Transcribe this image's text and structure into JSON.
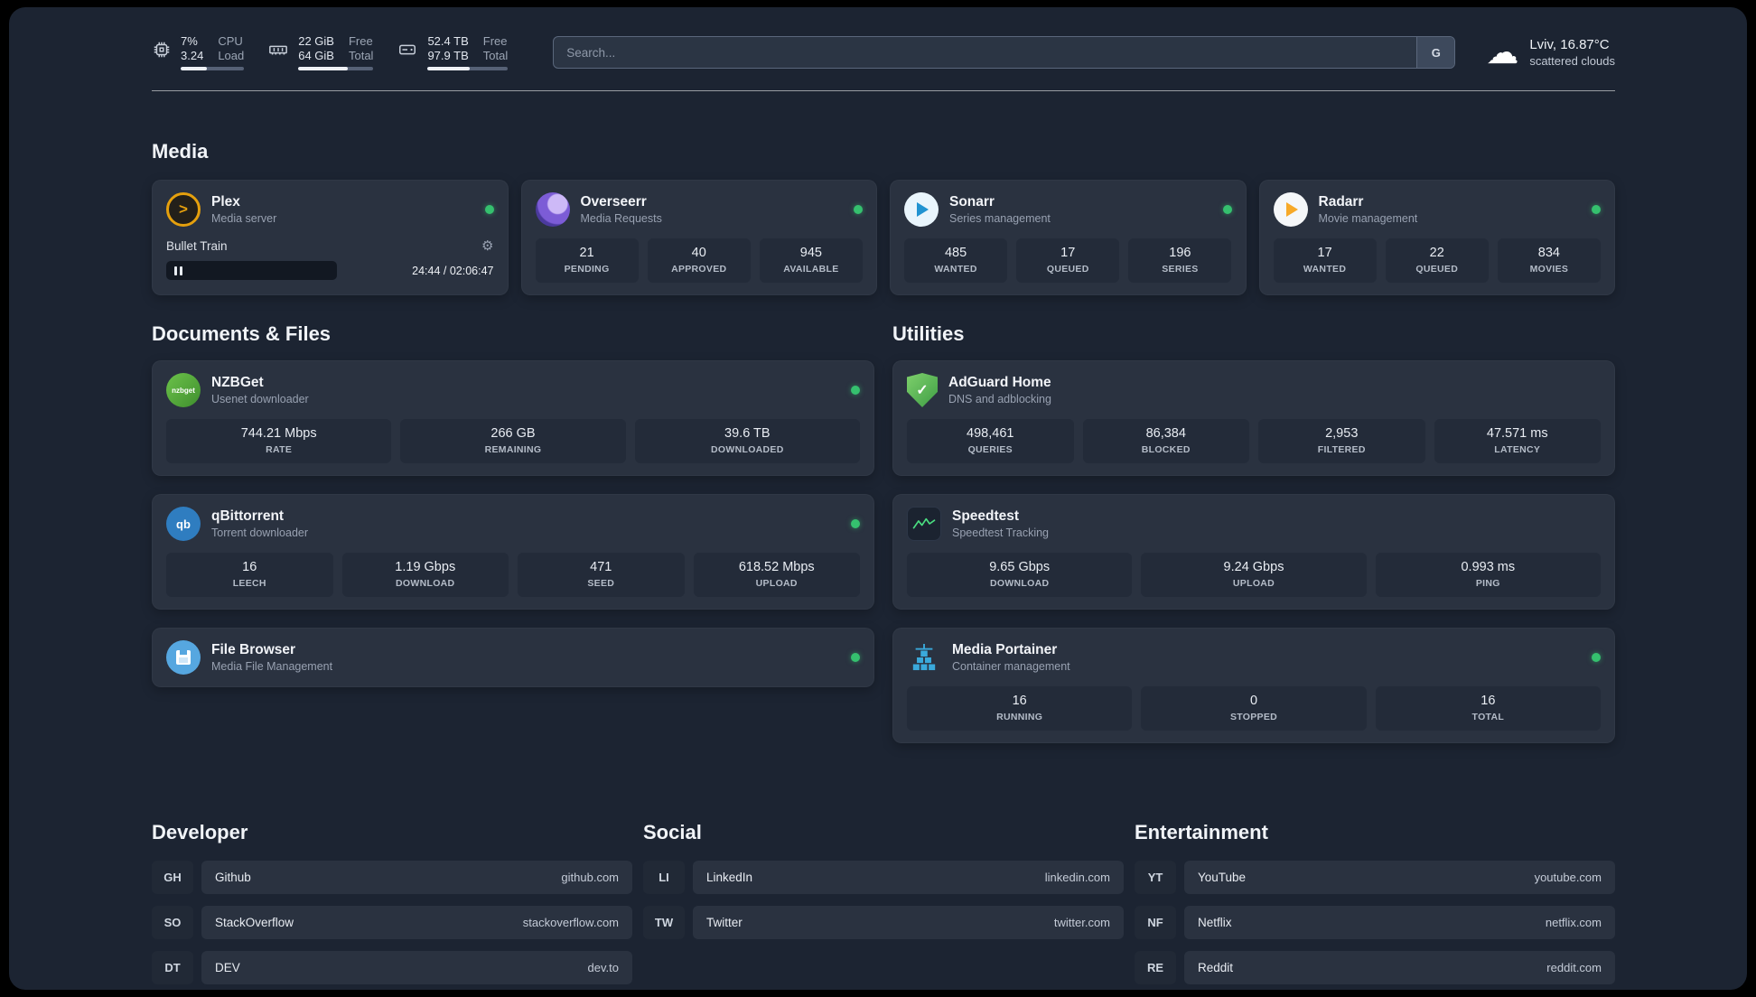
{
  "colors": {
    "panel_bg": "#1c2432",
    "card_bg": "#2a3240",
    "stat_bg": "#232b39",
    "status_green": "#35c06e",
    "plex_amber": "#e5a00d",
    "adguard_green": "#4caf50",
    "speedtest_green": "#4ade80",
    "portainer_blue": "#3aa9db"
  },
  "icons": {
    "gear": "⚙",
    "cloud": "☁",
    "check": "✓",
    "plex_chevron": ">"
  },
  "header": {
    "cpu": {
      "percent": "7%",
      "load": "3.24",
      "label_top": "CPU",
      "label_bottom": "Load"
    },
    "memory": {
      "free": "22 GiB",
      "total": "64 GiB",
      "label_top": "Free",
      "label_bottom": "Total"
    },
    "disk": {
      "free": "52.4 TB",
      "total": "97.9 TB",
      "label_top": "Free",
      "label_bottom": "Total"
    },
    "search": {
      "placeholder": "Search...",
      "button": "G"
    },
    "weather": {
      "location": "Lviv, 16.87°C",
      "condition": "scattered clouds"
    }
  },
  "media": {
    "title": "Media",
    "plex": {
      "name": "Plex",
      "subtitle": "Media server",
      "track": "Bullet Train",
      "time": "24:44 / 02:06:47"
    },
    "overseerr": {
      "name": "Overseerr",
      "subtitle": "Media Requests",
      "stats": [
        {
          "value": "21",
          "label": "PENDING"
        },
        {
          "value": "40",
          "label": "APPROVED"
        },
        {
          "value": "945",
          "label": "AVAILABLE"
        }
      ]
    },
    "sonarr": {
      "name": "Sonarr",
      "subtitle": "Series management",
      "stats": [
        {
          "value": "485",
          "label": "WANTED"
        },
        {
          "value": "17",
          "label": "QUEUED"
        },
        {
          "value": "196",
          "label": "SERIES"
        }
      ]
    },
    "radarr": {
      "name": "Radarr",
      "subtitle": "Movie management",
      "stats": [
        {
          "value": "17",
          "label": "WANTED"
        },
        {
          "value": "22",
          "label": "QUEUED"
        },
        {
          "value": "834",
          "label": "MOVIES"
        }
      ]
    }
  },
  "documents": {
    "title": "Documents & Files",
    "nzbget": {
      "name": "NZBGet",
      "subtitle": "Usenet downloader",
      "icon_text": "nzbget",
      "stats": [
        {
          "value": "744.21 Mbps",
          "label": "RATE"
        },
        {
          "value": "266 GB",
          "label": "REMAINING"
        },
        {
          "value": "39.6 TB",
          "label": "DOWNLOADED"
        }
      ]
    },
    "qbittorrent": {
      "name": "qBittorrent",
      "subtitle": "Torrent downloader",
      "icon_text": "qb",
      "stats": [
        {
          "value": "16",
          "label": "LEECH"
        },
        {
          "value": "1.19 Gbps",
          "label": "DOWNLOAD"
        },
        {
          "value": "471",
          "label": "SEED"
        },
        {
          "value": "618.52 Mbps",
          "label": "UPLOAD"
        }
      ]
    },
    "filebrowser": {
      "name": "File Browser",
      "subtitle": "Media File Management"
    }
  },
  "utilities": {
    "title": "Utilities",
    "adguard": {
      "name": "AdGuard Home",
      "subtitle": "DNS and adblocking",
      "stats": [
        {
          "value": "498,461",
          "label": "QUERIES"
        },
        {
          "value": "86,384",
          "label": "BLOCKED"
        },
        {
          "value": "2,953",
          "label": "FILTERED"
        },
        {
          "value": "47.571 ms",
          "label": "LATENCY"
        }
      ]
    },
    "speedtest": {
      "name": "Speedtest",
      "subtitle": "Speedtest Tracking",
      "stats": [
        {
          "value": "9.65 Gbps",
          "label": "DOWNLOAD"
        },
        {
          "value": "9.24 Gbps",
          "label": "UPLOAD"
        },
        {
          "value": "0.993 ms",
          "label": "PING"
        }
      ]
    },
    "portainer": {
      "name": "Media Portainer",
      "subtitle": "Container management",
      "stats": [
        {
          "value": "16",
          "label": "RUNNING"
        },
        {
          "value": "0",
          "label": "STOPPED"
        },
        {
          "value": "16",
          "label": "TOTAL"
        }
      ]
    }
  },
  "bookmarks": {
    "developer": {
      "title": "Developer",
      "items": [
        {
          "abbr": "GH",
          "name": "Github",
          "url": "github.com"
        },
        {
          "abbr": "SO",
          "name": "StackOverflow",
          "url": "stackoverflow.com"
        },
        {
          "abbr": "DT",
          "name": "DEV",
          "url": "dev.to"
        }
      ]
    },
    "social": {
      "title": "Social",
      "items": [
        {
          "abbr": "LI",
          "name": "LinkedIn",
          "url": "linkedin.com"
        },
        {
          "abbr": "TW",
          "name": "Twitter",
          "url": "twitter.com"
        }
      ]
    },
    "entertainment": {
      "title": "Entertainment",
      "items": [
        {
          "abbr": "YT",
          "name": "YouTube",
          "url": "youtube.com"
        },
        {
          "abbr": "NF",
          "name": "Netflix",
          "url": "netflix.com"
        },
        {
          "abbr": "RE",
          "name": "Reddit",
          "url": "reddit.com"
        }
      ]
    }
  }
}
